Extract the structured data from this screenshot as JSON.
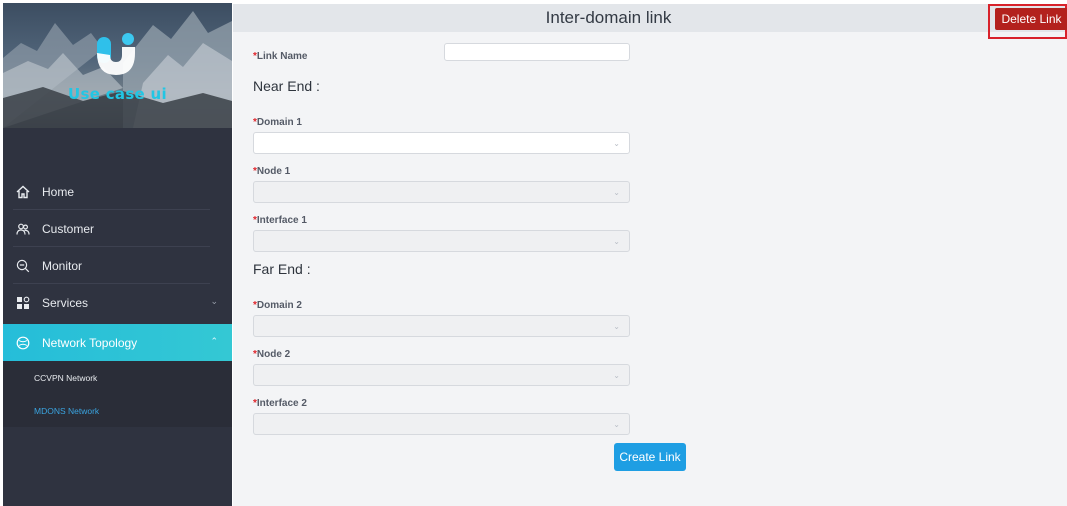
{
  "app": {
    "name": "Use case ui"
  },
  "sidebar": {
    "menu": [
      {
        "label": "Home",
        "icon": "home-icon"
      },
      {
        "label": "Customer",
        "icon": "customer-icon"
      },
      {
        "label": "Monitor",
        "icon": "monitor-icon"
      },
      {
        "label": "Services",
        "icon": "services-icon",
        "expandable": true
      },
      {
        "label": "Network Topology",
        "icon": "network-topology-icon",
        "expandable": true,
        "active": true
      }
    ],
    "submenu": [
      {
        "label": "CCVPN Network"
      },
      {
        "label": "MDONS Network",
        "current": true
      }
    ]
  },
  "page": {
    "title": "Inter-domain link"
  },
  "actions": {
    "delete_link": "Delete Link",
    "create_link": "Create Link"
  },
  "form": {
    "required_marker": "*",
    "link_name": {
      "label": "Link Name",
      "value": ""
    },
    "near_end": {
      "heading": "Near End :",
      "domain": {
        "label": "Domain 1",
        "value": "",
        "disabled": false
      },
      "node": {
        "label": "Node 1",
        "value": "",
        "disabled": true
      },
      "interface": {
        "label": "Interface 1",
        "value": "",
        "disabled": true
      }
    },
    "far_end": {
      "heading": "Far End :",
      "domain": {
        "label": "Domain 2",
        "value": "",
        "disabled": true
      },
      "node": {
        "label": "Node 2",
        "value": "",
        "disabled": true
      },
      "interface": {
        "label": "Interface 2",
        "value": "",
        "disabled": true
      }
    }
  },
  "colors": {
    "sidebar_bg": "#2f3340",
    "active_menu": "#25bdd9",
    "brand_text": "#22c6e4",
    "delete_button": "#b3211d",
    "delete_highlight": "#d8222b",
    "create_button": "#1e9ee3",
    "required_marker": "#e0262d",
    "current_submenu": "#3aa4e0"
  }
}
